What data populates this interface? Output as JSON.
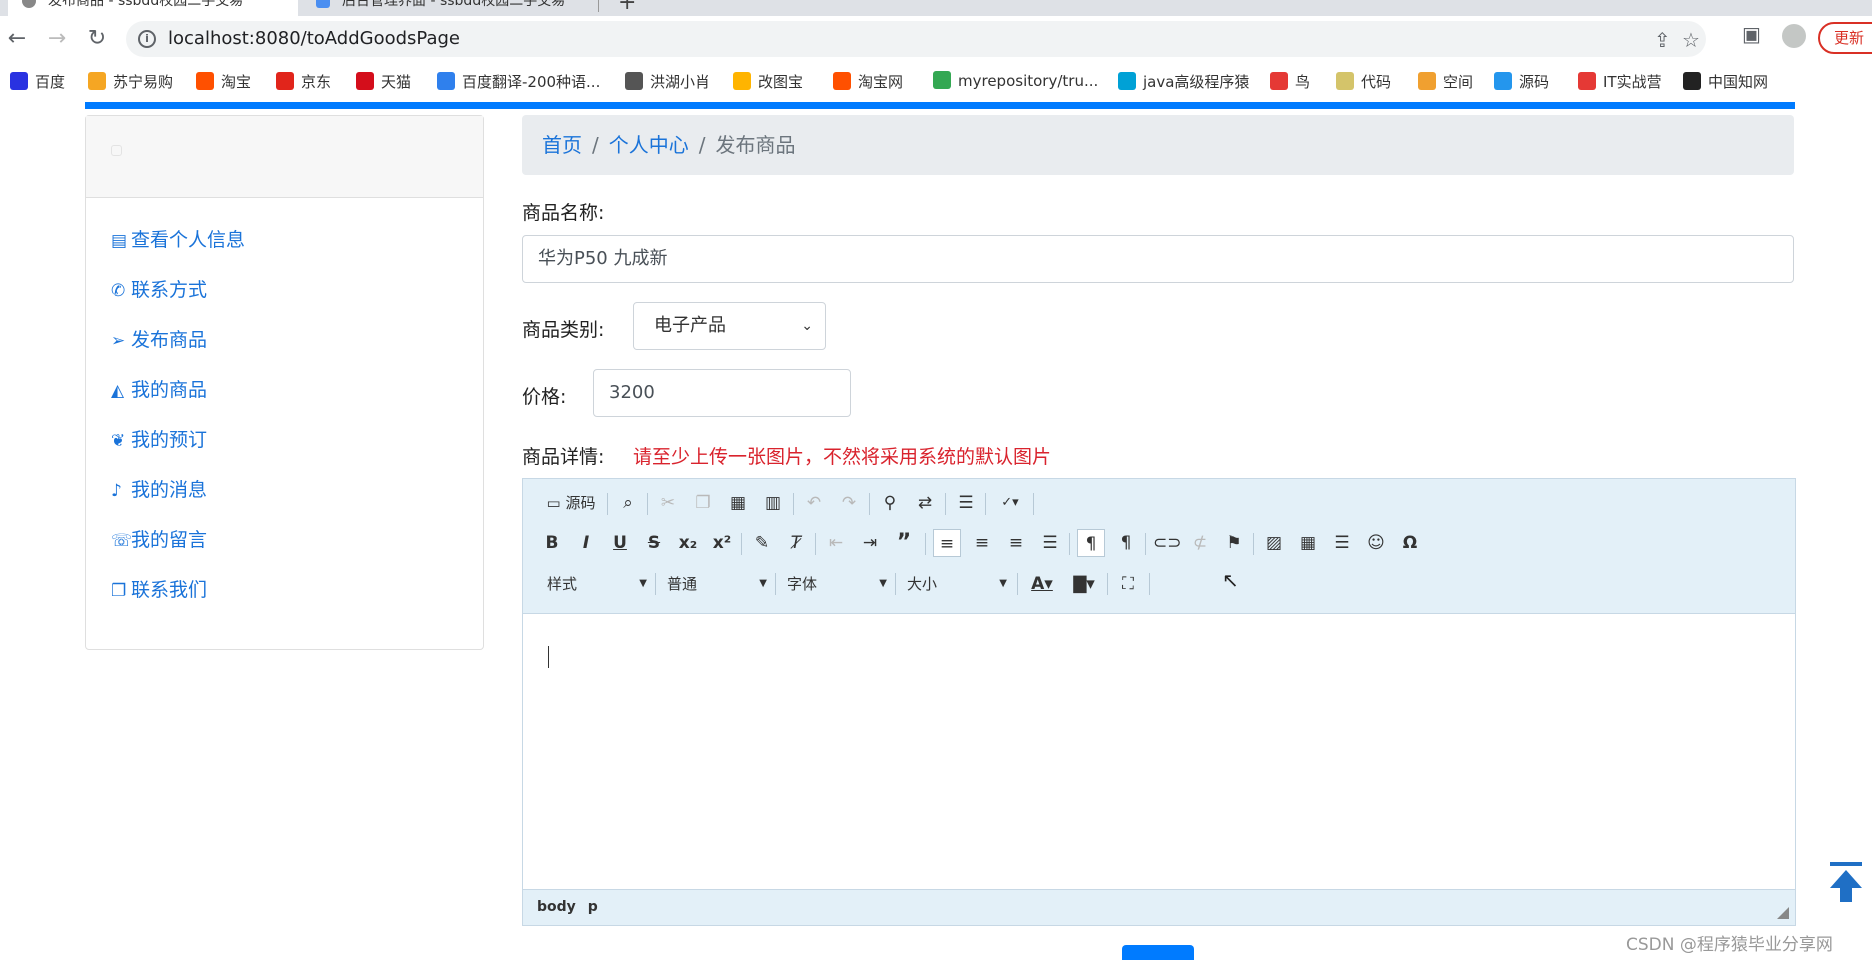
{
  "browser": {
    "tabs": [
      {
        "label": "发布商品 - ssbdd校园二手交易"
      },
      {
        "label": "后台管理界面 - ssbdd校园二手交易"
      }
    ],
    "new_tab": "+",
    "url": "localhost:8080/toAddGoodsPage",
    "update_label": "更新",
    "bookmarks": [
      {
        "label": "百度",
        "icon": "baidu-icon",
        "color": "#2932e1"
      },
      {
        "label": "苏宁易购",
        "icon": "suning-icon",
        "color": "#f5a623"
      },
      {
        "label": "淘宝",
        "icon": "taobao-icon",
        "color": "#ff5000"
      },
      {
        "label": "京东",
        "icon": "jd-icon",
        "color": "#e1251b"
      },
      {
        "label": "天猫",
        "icon": "tmall-icon",
        "color": "#d40e1b"
      },
      {
        "label": "百度翻译-200种语...",
        "icon": "translate-icon",
        "color": "#2f80ed"
      },
      {
        "label": "洪湖小肖",
        "icon": "hand-icon",
        "color": "#555555"
      },
      {
        "label": "改图宝",
        "icon": "gaitubao-icon",
        "color": "#ffb400"
      },
      {
        "label": "淘宝网",
        "icon": "taobao-icon",
        "color": "#ff5000"
      },
      {
        "label": "myrepository/tru...",
        "icon": "chrome-icon",
        "color": "#34a853"
      },
      {
        "label": "java高级程序猿",
        "icon": "bilibili-icon",
        "color": "#00a1d6"
      },
      {
        "label": "鸟",
        "icon": "bird-icon",
        "color": "#e53935"
      },
      {
        "label": "代码",
        "icon": "moon-icon",
        "color": "#d4c46a"
      },
      {
        "label": "空间",
        "icon": "qzone-icon",
        "color": "#f0a030"
      },
      {
        "label": "源码",
        "icon": "docker-icon",
        "color": "#2496ed"
      },
      {
        "label": "IT实战营",
        "icon": "it-icon",
        "color": "#e53935"
      },
      {
        "label": "中国知网",
        "icon": "cnki-icon",
        "color": "#222222"
      }
    ]
  },
  "sidebar": {
    "items": [
      {
        "label": "查看个人信息",
        "icon": "id-card-icon"
      },
      {
        "label": "联系方式",
        "icon": "phone-icon"
      },
      {
        "label": "发布商品",
        "icon": "send-icon"
      },
      {
        "label": "我的商品",
        "icon": "shopping-bag-icon"
      },
      {
        "label": "我的预订",
        "icon": "leaf-icon"
      },
      {
        "label": "我的消息",
        "icon": "bell-icon"
      },
      {
        "label": "我的留言",
        "icon": "comment-icon"
      },
      {
        "label": "联系我们",
        "icon": "copy-icon"
      }
    ]
  },
  "breadcrumb": {
    "home": "首页",
    "sep": "/",
    "center": "个人中心",
    "current": "发布商品"
  },
  "form": {
    "name_label": "商品名称:",
    "name_value": "华为P50 九成新",
    "category_label": "商品类别:",
    "category_value": "电子产品",
    "price_label": "价格:",
    "price_value": "3200",
    "detail_label": "商品详情:",
    "detail_warning": "请至少上传一张图片，不然将采用系统的默认图片"
  },
  "editor": {
    "source_label": "源码",
    "style_combo": "样式",
    "format_combo": "普通",
    "font_combo": "字体",
    "size_combo": "大小",
    "path": [
      "body",
      "p"
    ]
  },
  "watermark": "CSDN @程序猿毕业分享网",
  "colors": {
    "accent": "#007bff",
    "link": "#1a73d9",
    "warning": "#d9232d",
    "editor_bar": "#e3f0f8"
  }
}
